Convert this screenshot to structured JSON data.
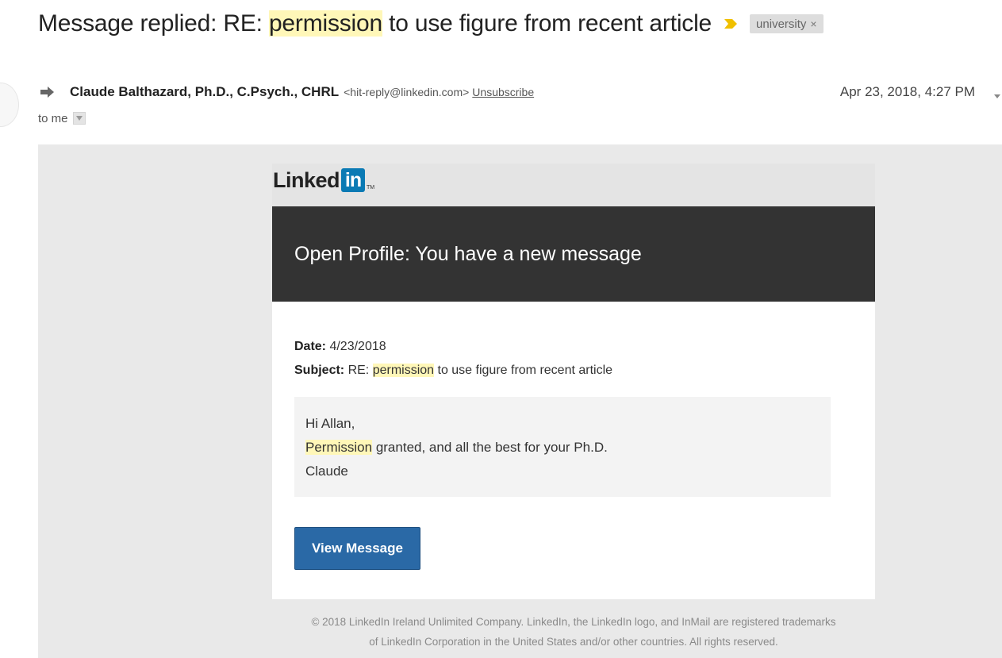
{
  "subject": {
    "prefix": "Message replied: RE: ",
    "highlight": "permission",
    "suffix": " to use figure from recent article",
    "label": "university",
    "label_remove": "×"
  },
  "sender": {
    "name": "Claude Balthazard, Ph.D., C.Psych., CHRL",
    "email": "<hit-reply@linkedin.com>",
    "unsubscribe": "Unsubscribe",
    "date": "Apr 23, 2018, 4:27 PM",
    "to": "to me"
  },
  "linkedin": {
    "logo_word": "Linked",
    "logo_in": "in",
    "logo_tm": "TM",
    "header_title": "Open Profile: You have a new message",
    "date_label": "Date:",
    "date_value": " 4/23/2018",
    "subject_label": "Subject:",
    "subject_prefix": " RE: ",
    "subject_highlight": "permission",
    "subject_suffix": " to use figure from recent article",
    "greeting": "Hi Allan,",
    "body_highlight": "Permission",
    "body_rest": " granted, and all the best for your Ph.D.",
    "signoff": "Claude",
    "button_label": "View Message",
    "footer_line1": "© 2018 LinkedIn Ireland Unlimited Company. LinkedIn, the LinkedIn logo, and InMail are registered trademarks",
    "footer_line2": "of LinkedIn Corporation in the United States and/or other countries. All rights reserved."
  },
  "colors": {
    "importance": "#f0c000",
    "highlight": "#fff7b8",
    "linkedin_blue": "#0a7ab4",
    "button": "#2a69a6",
    "header_dark": "#333333"
  }
}
